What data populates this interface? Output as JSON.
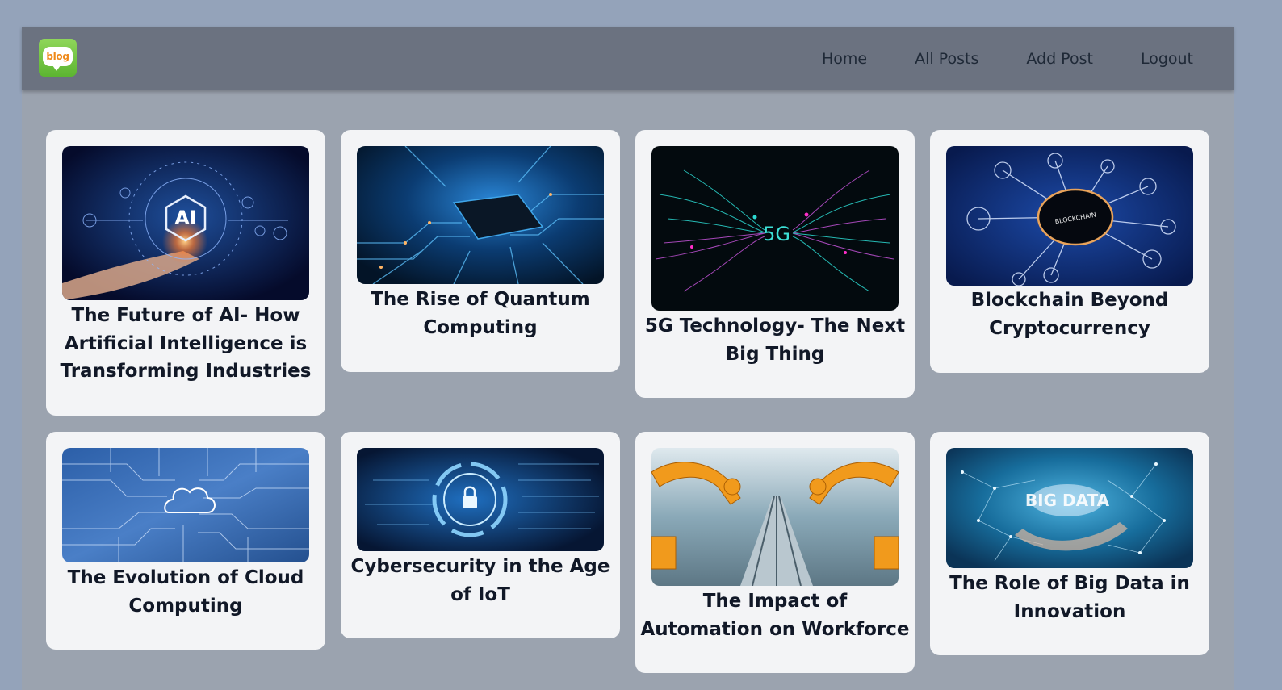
{
  "navbar": {
    "logo_text": "blog",
    "links": [
      {
        "label": "Home"
      },
      {
        "label": "All Posts"
      },
      {
        "label": "Add Post"
      },
      {
        "label": "Logout"
      }
    ]
  },
  "posts": [
    {
      "title": "The Future of AI- How Artificial Intelligence is Transforming Industries",
      "image_text": "AI"
    },
    {
      "title": "The Rise of Quantum Computing"
    },
    {
      "title": "5G Technology- The Next Big Thing",
      "image_text": "5G"
    },
    {
      "title": "Blockchain Beyond Cryptocurrency",
      "image_text": "BLOCKCHAIN"
    },
    {
      "title": "The Evolution of Cloud Computing"
    },
    {
      "title": "Cybersecurity in the Age of IoT"
    },
    {
      "title": "The Impact of Automation on Workforce"
    },
    {
      "title": "The Role of Big Data in Innovation",
      "image_text": "BIG DATA"
    }
  ]
}
